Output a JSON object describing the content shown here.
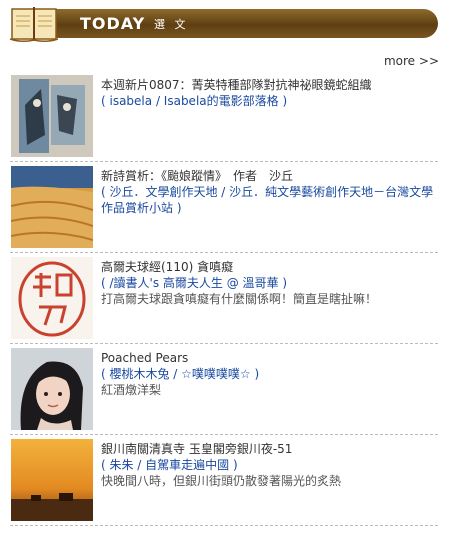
{
  "header": {
    "title": "TODAY",
    "subtitle": "選 文"
  },
  "more_label": "more >>",
  "items": [
    {
      "title": "本週新片0807：菁英特種部隊對抗神祕眼鏡蛇組織",
      "source": "( isabela / Isabela的電影部落格 )",
      "desc": ""
    },
    {
      "title": "新詩賞析：《颱娘蹤情》　作者　沙丘",
      "source": "( 沙丘．文學創作天地 / 沙丘．純文學藝術創作天地－台灣文學作品賞析小站 )",
      "desc": ""
    },
    {
      "title": "高爾夫球經(110) 貪嗔癡",
      "source": "( /讀書人's 高爾夫人生 @ 溫哥華 )",
      "desc": "打高爾夫球跟貪嗔癡有什麼關係啊！簡直是瞎扯嘛！"
    },
    {
      "title": "Poached Pears",
      "source": "( 櫻桃木木兔 / ☆噗噗噗噗☆ )",
      "desc": "紅酒燉洋梨"
    },
    {
      "title": "銀川南關清真寺 玉皇閣旁銀川夜-51",
      "source": "( 朱朱 / 自駕車走遍中國 )",
      "desc": "快晚間八時，但銀川街頭仍散發著陽光的炙熱"
    }
  ],
  "colors": {
    "banner": "#6b4a1a",
    "link": "#1a4aa0",
    "divider": "#bbbbbb"
  }
}
